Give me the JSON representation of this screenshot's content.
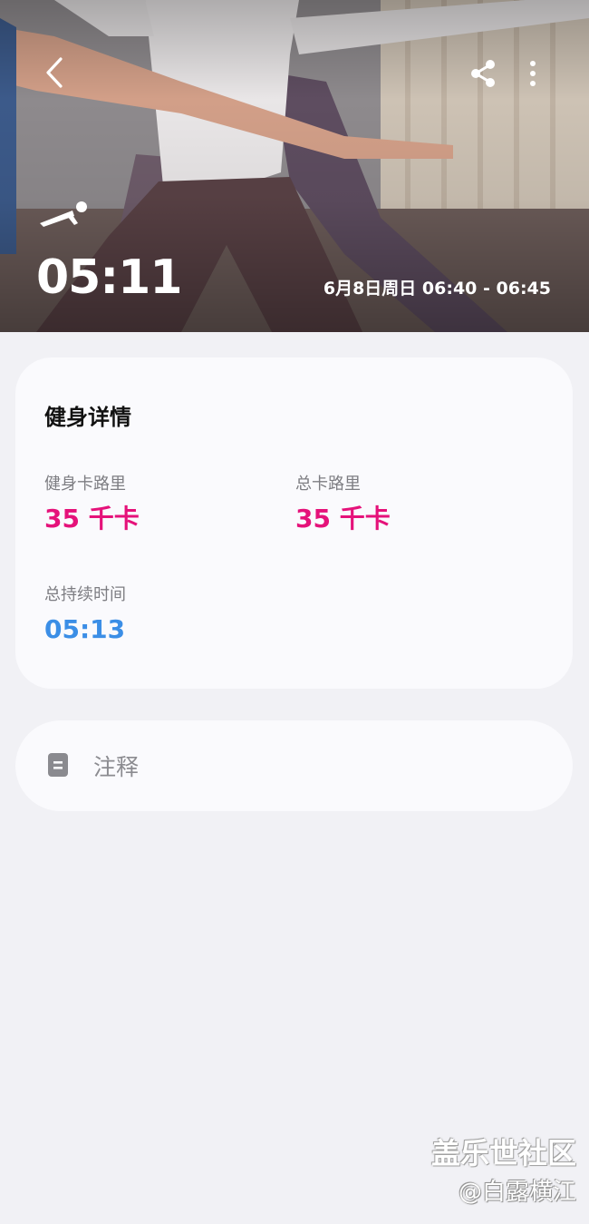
{
  "header": {
    "back_icon": "chevron-left-icon",
    "share_icon": "share-icon",
    "more_icon": "more-vertical-icon",
    "workout_type_icon": "plank-icon",
    "duration": "05:11",
    "time_range": "6月8日周日 06:40 - 06:45"
  },
  "details": {
    "title": "健身详情",
    "metrics": [
      {
        "label": "健身卡路里",
        "value": "35 千卡",
        "color": "#e5127a"
      },
      {
        "label": "总卡路里",
        "value": "35 千卡",
        "color": "#e5127a"
      },
      {
        "label": "总持续时间",
        "value": "05:13",
        "color": "#3b8ee6"
      }
    ]
  },
  "notes": {
    "icon": "note-icon",
    "label": "注释"
  },
  "watermark": {
    "line1": "盖乐世社区",
    "line2": "@白露横江"
  }
}
